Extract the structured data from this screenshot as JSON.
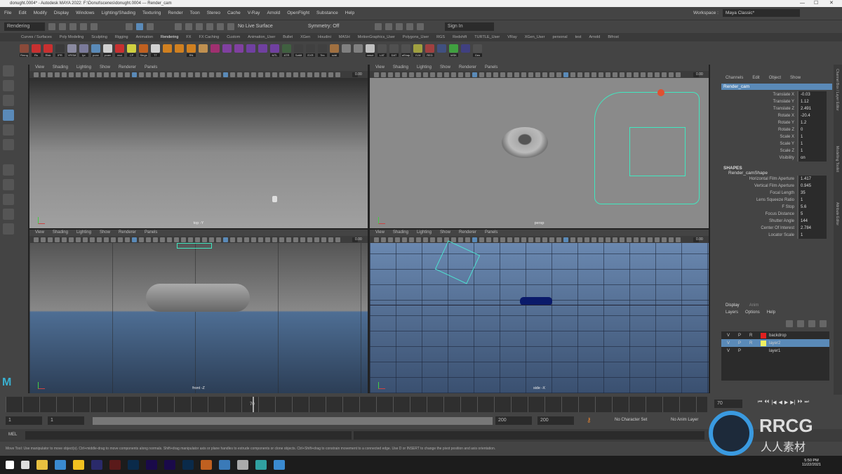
{
  "window": {
    "title": "donught.0004* - Autodesk MAYA 2022: F:\\Donut\\scenes\\donught.0004  ---  Render_cam",
    "controls": [
      "—",
      "☐",
      "✕"
    ]
  },
  "menubar": {
    "items": [
      "File",
      "Edit",
      "Modify",
      "Display",
      "Windows",
      "Lighting/Shading",
      "Texturing",
      "Render",
      "Toon",
      "Stereo",
      "Cache",
      "V-Ray",
      "Arnold",
      "OpenFlight",
      "Substance",
      "Help"
    ],
    "workspace_label": "Workspace :",
    "workspace_value": "Maya Classic*"
  },
  "status": {
    "mode": "Rendering",
    "live_surface": "No Live Surface",
    "symmetry": "Symmetry: Off",
    "sign_in": "Sign In"
  },
  "shelf": {
    "tabs": [
      "Curves / Surfaces",
      "Poly Modeling",
      "Sculpting",
      "Rigging",
      "Animation",
      "Rendering",
      "FX",
      "FX Caching",
      "Custom",
      "Animation_User",
      "Bullet",
      "XGen",
      "Houdini",
      "MASH",
      "MotionGraphics_User",
      "Polygons_User",
      "RGS",
      "Redshift",
      "TURTLE_User",
      "VRay",
      "XGen_User",
      "personal",
      "test",
      "Arnold",
      "Bifrost"
    ],
    "icons": [
      {
        "label": "Rmng",
        "color": "#8a4a3a"
      },
      {
        "label": "Rs",
        "color": "#c83030"
      },
      {
        "label": "Rtsk",
        "color": "#c83030"
      },
      {
        "label": "IPR",
        "color": "#3a3a3a"
      },
      {
        "label": "VRSM",
        "color": "#8a8aa0"
      },
      {
        "label": "Ipr",
        "color": "#7a7a9a"
      },
      {
        "label": "ponv",
        "color": "#5a8ab8"
      },
      {
        "label": "pcam",
        "color": "#d0d0d0"
      },
      {
        "label": "rect",
        "color": "#c83030"
      },
      {
        "label": "CP",
        "color": "#d0d040"
      },
      {
        "label": "Stngs",
        "color": "#c06020"
      },
      {
        "label": "TT",
        "color": "#d0d0d0"
      },
      {
        "label": "",
        "color": "#d08020"
      },
      {
        "label": "",
        "color": "#d08020"
      },
      {
        "label": "RN",
        "color": "#d08020"
      },
      {
        "label": "",
        "color": "#c09050"
      },
      {
        "label": "",
        "color": "#a03070"
      },
      {
        "label": "",
        "color": "#8040a0"
      },
      {
        "label": "",
        "color": "#8040a0"
      },
      {
        "label": "",
        "color": "#7040a0"
      },
      {
        "label": "",
        "color": "#7040a0"
      },
      {
        "label": "MTL",
        "color": "#7040a0"
      },
      {
        "label": "ATR",
        "color": "#406040"
      },
      {
        "label": "SaMt",
        "color": "#404040"
      },
      {
        "label": "EXR",
        "color": "#404040"
      },
      {
        "label": "Tex",
        "color": "#404040"
      },
      {
        "label": "sctrl",
        "color": "#a07040"
      },
      {
        "label": "",
        "color": "#808080"
      },
      {
        "label": "",
        "color": "#808080"
      },
      {
        "label": "mrsct",
        "color": "#c0c0c0"
      },
      {
        "label": "LAT",
        "color": "#505050"
      },
      {
        "label": "DAT",
        "color": "#505050"
      },
      {
        "label": "aShap",
        "color": "#505050"
      },
      {
        "label": "YLW",
        "color": "#a0a040"
      },
      {
        "label": "RED",
        "color": "#a04040"
      },
      {
        "label": "",
        "color": "#405080"
      },
      {
        "label": "MSK",
        "color": "#40a040"
      },
      {
        "label": "",
        "color": "#404080"
      },
      {
        "label": "Geo",
        "color": "#505050"
      }
    ]
  },
  "viewports": [
    {
      "menu": [
        "View",
        "Shading",
        "Lighting",
        "Show",
        "Renderer",
        "Panels"
      ],
      "value": "0.00",
      "label": "top -Y"
    },
    {
      "menu": [
        "View",
        "Shading",
        "Lighting",
        "Show",
        "Renderer",
        "Panels"
      ],
      "value": "0.00",
      "label": "persp"
    },
    {
      "menu": [
        "View",
        "Shading",
        "Lighting",
        "Show",
        "Renderer",
        "Panels"
      ],
      "value": "0.00",
      "label": "front -Z"
    },
    {
      "menu": [
        "View",
        "Shading",
        "Lighting",
        "Show",
        "Renderer",
        "Panels"
      ],
      "value": "0.00",
      "label": "side -X"
    }
  ],
  "channel_box": {
    "menu": [
      "Channels",
      "Edit",
      "Object",
      "Show"
    ],
    "object": "Render_cam",
    "attributes": [
      {
        "name": "Translate X",
        "value": "-0.03"
      },
      {
        "name": "Translate Y",
        "value": "1.12"
      },
      {
        "name": "Translate Z",
        "value": "2.491"
      },
      {
        "name": "Rotate X",
        "value": "-20.4"
      },
      {
        "name": "Rotate Y",
        "value": "1.2"
      },
      {
        "name": "Rotate Z",
        "value": "0"
      },
      {
        "name": "Scale X",
        "value": "1"
      },
      {
        "name": "Scale Y",
        "value": "1"
      },
      {
        "name": "Scale Z",
        "value": "1"
      },
      {
        "name": "Visibility",
        "value": "on"
      }
    ],
    "shapes_header": "SHAPES",
    "shape_name": "Render_camShape",
    "shape_attributes": [
      {
        "name": "Horizontal Film Aperture",
        "value": "1.417"
      },
      {
        "name": "Vertical Film Aperture",
        "value": "0.945"
      },
      {
        "name": "Focal Length",
        "value": "35"
      },
      {
        "name": "Lens Squeeze Ratio",
        "value": "1"
      },
      {
        "name": "F Stop",
        "value": "5.6"
      },
      {
        "name": "Focus Distance",
        "value": "5"
      },
      {
        "name": "Shutter Angle",
        "value": "144"
      },
      {
        "name": "Center Of Interest",
        "value": "2.784"
      },
      {
        "name": "Locator Scale",
        "value": "1"
      }
    ]
  },
  "layer_editor": {
    "tabs": [
      "Display",
      "Anim"
    ],
    "menu": [
      "Layers",
      "Options",
      "Help"
    ],
    "layers": [
      {
        "v": "V",
        "p": "P",
        "r": "R",
        "color": "#e02020",
        "name": "backdrop",
        "selected": false
      },
      {
        "v": "V",
        "p": "P",
        "r": "R",
        "color": "#f0f060",
        "name": "layer2",
        "selected": true
      },
      {
        "v": "V",
        "p": "P",
        "r": "",
        "color": "",
        "name": "layer1",
        "selected": false
      }
    ]
  },
  "right_tabs": [
    "Channel Box / Layer Editor",
    "Modelling Toolkit",
    "Attribute Editor"
  ],
  "timeline": {
    "current_frame": "70",
    "frame_field": "70",
    "playback": [
      "⏮",
      "⏴⏴",
      "|◀",
      "◀",
      "▶",
      "▶|",
      "⏵⏵",
      "⏭"
    ]
  },
  "range": {
    "start": "1",
    "inner_start": "1",
    "inner_end": "200",
    "end": "200",
    "end2": "200",
    "character_set": "No Character Set",
    "anim_layer": "No Anim Layer"
  },
  "mel": {
    "label": "MEL"
  },
  "help_line": "Move Tool: Use manipulator to move object(s). Ctrl+middle-drag to move components along normals. Shift+drag manipulator axis or plane handles to extrude components or clone objects. Ctrl+Shift+drag to constrain movement to a connected edge. Use D or INSERT to change the pivot position and axis orientation.",
  "taskbar": {
    "time": "5:50 PM",
    "date": "11/22/2021",
    "apps": [
      {
        "name": "start",
        "color": "#ffffff"
      },
      {
        "name": "search",
        "color": "#dddddd"
      },
      {
        "name": "file-explorer",
        "color": "#e8c040"
      },
      {
        "name": "app",
        "color": "#3a8ad0"
      },
      {
        "name": "sticky",
        "color": "#f0c020"
      },
      {
        "name": "media-encoder",
        "color": "#2a2a6a"
      },
      {
        "name": "illustrator",
        "color": "#5a1a1a"
      },
      {
        "name": "photoshop",
        "color": "#0a2a4a"
      },
      {
        "name": "premiere",
        "color": "#1a0a4a"
      },
      {
        "name": "after-effects",
        "color": "#1a0a4a"
      },
      {
        "name": "audition",
        "color": "#0a2a4a"
      },
      {
        "name": "houdini",
        "color": "#c06020"
      },
      {
        "name": "x-app",
        "color": "#3a7ab8"
      },
      {
        "name": "app2",
        "color": "#aaaaaa"
      },
      {
        "name": "maya",
        "color": "#30a0a0"
      },
      {
        "name": "app3",
        "color": "#3a8ad0"
      }
    ]
  },
  "watermark": "RRCG 人人素材"
}
